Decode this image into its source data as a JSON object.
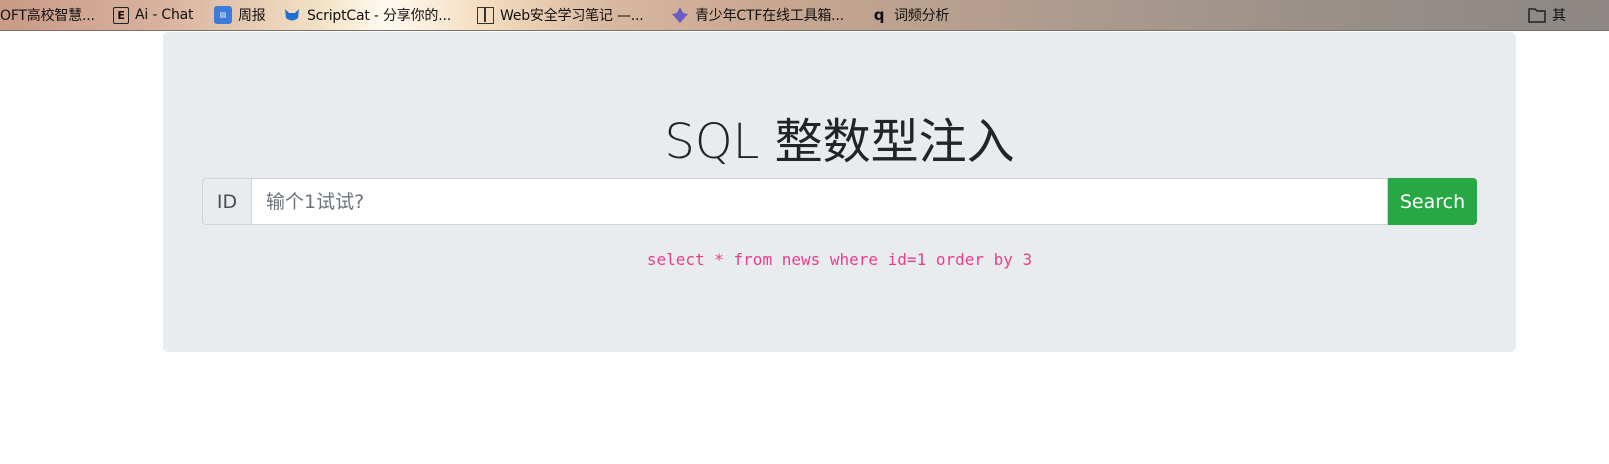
{
  "bookmarks": [
    {
      "label": "OFT高校智慧...",
      "icon": "none"
    },
    {
      "label": "Ai - Chat",
      "icon": "e-letter-icon"
    },
    {
      "label": "周报",
      "icon": "blue-app-icon"
    },
    {
      "label": "ScriptCat - 分享你的...",
      "icon": "cat-icon"
    },
    {
      "label": "Web安全学习笔记 —...",
      "icon": "book-icon"
    },
    {
      "label": "青少年CTF在线工具箱...",
      "icon": "ctf-logo-icon"
    },
    {
      "label": "词频分析",
      "icon": "q-icon"
    }
  ],
  "bookmark_folder": {
    "label": "其",
    "icon": "folder-icon"
  },
  "page": {
    "title": "SQL 整数型注入",
    "id_label": "ID",
    "input_placeholder": "输个1试试?",
    "search_label": "Search",
    "query_text": "select * from news where id=1 order by 3"
  },
  "colors": {
    "jumbotron_bg": "#e9ecef",
    "search_button": "#28a745",
    "query_text": "#e83e8c"
  }
}
